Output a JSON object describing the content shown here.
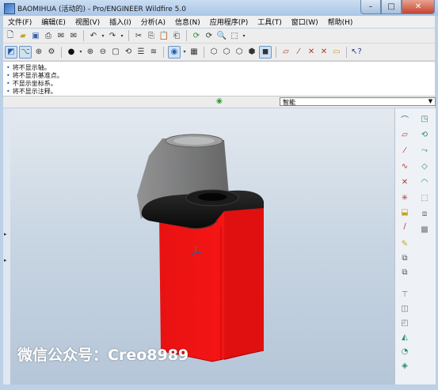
{
  "window": {
    "title": "BAOMIHUA (活动的) - Pro/ENGINEER Wildfire 5.0"
  },
  "menu": [
    "文件(F)",
    "编辑(E)",
    "视图(V)",
    "插入(I)",
    "分析(A)",
    "信息(N)",
    "应用程序(P)",
    "工具(T)",
    "窗口(W)",
    "帮助(H)"
  ],
  "messages": [
    "将不显示轴。",
    "将不显示基准点。",
    "不显示坐标系。",
    "将不显示注释。"
  ],
  "filter": {
    "value": "智能"
  },
  "watermark": "微信公众号：Creo8989",
  "colors": {
    "body_red": "#ee1111",
    "cap_black": "#151515",
    "gray_shell": "#6d6d6d"
  }
}
